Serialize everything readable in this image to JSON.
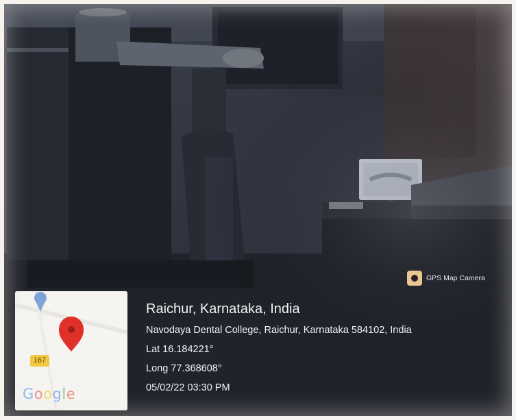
{
  "gps_overlay": {
    "badge_label": "GPS Map Camera",
    "badge_icon": "camera-app-icon",
    "location_title": "Raichur, Karnataka, India",
    "address": "Navodaya Dental College, Raichur, Karnataka 584102, India",
    "latitude": "Lat 16.184221°",
    "longitude": "Long 77.368608°",
    "datetime": "05/02/22 03:30 PM"
  },
  "map_thumbnail": {
    "road_shield": "167",
    "brand": "Google",
    "pin_icon": "map-pin-icon",
    "pin_color": "#e0302a"
  },
  "colors": {
    "room_dark": "#2b2f3a",
    "overlay_text": "#f2f2f4"
  }
}
